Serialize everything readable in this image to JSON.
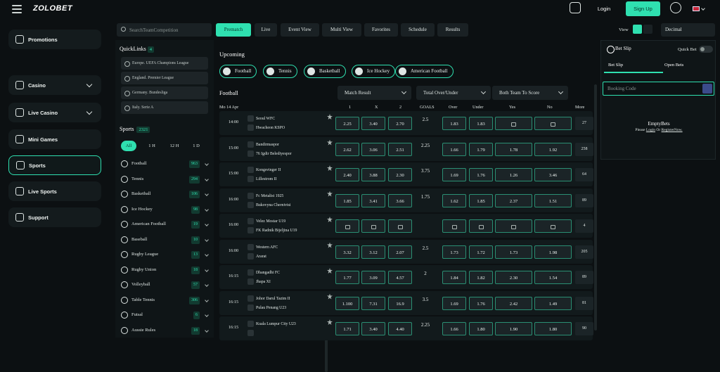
{
  "header": {
    "logo": "ZOLOBET",
    "login": "Login",
    "signup": "Sign Up",
    "lang": "EN"
  },
  "sidebar": {
    "items": [
      {
        "label": "Promotions",
        "icon": "gift-icon"
      },
      {
        "label": "Casino",
        "icon": "casino-chip-icon"
      },
      {
        "label": "Live Casino",
        "icon": "live-casino-icon"
      },
      {
        "label": "Mini Games",
        "icon": "rocket-icon"
      },
      {
        "label": "Sports",
        "icon": "ball-icon"
      },
      {
        "label": "Live Sports",
        "icon": "live-icon"
      },
      {
        "label": "Support",
        "icon": "headset-icon"
      }
    ]
  },
  "filter": {
    "search_placeholder": "SearchTeamCompetition",
    "tabs": [
      "Prematch",
      "Live",
      "Event View",
      "Multi View",
      "Favorites",
      "Schedule",
      "Results"
    ],
    "view_label": "View",
    "odds_format": "Decimal"
  },
  "quicklinks": {
    "title": "QuickLinks",
    "count": "4",
    "items": [
      "Europe. UEFA Champions League",
      "England. Premier League",
      "Germany. Bundesliga",
      "Italy. Serie A"
    ]
  },
  "sports": {
    "title": "Sports",
    "count": "2321",
    "chips": [
      "All",
      "1 H",
      "12 H",
      "1 D"
    ],
    "list": [
      {
        "name": "Football",
        "count": "963"
      },
      {
        "name": "Tennis",
        "count": "294"
      },
      {
        "name": "Basketball",
        "count": "106"
      },
      {
        "name": "Ice Hockey",
        "count": "98"
      },
      {
        "name": "American Football",
        "count": "19"
      },
      {
        "name": "Baseball",
        "count": "10"
      },
      {
        "name": "Rugby League",
        "count": "13"
      },
      {
        "name": "Rugby Union",
        "count": "18"
      },
      {
        "name": "Volleyball",
        "count": "57"
      },
      {
        "name": "Table Tennis",
        "count": "306"
      },
      {
        "name": "Futsal",
        "count": "6"
      },
      {
        "name": "Aussie Rules",
        "count": "18"
      }
    ]
  },
  "main": {
    "title": "Upcoming",
    "sport_buttons": [
      "Football",
      "Tennis",
      "Basketball",
      "Ice Hockey",
      "American Football"
    ],
    "section": "Football",
    "date": "Mo 14 Apr",
    "markets": [
      "Match Result",
      "Total Over/Under",
      "Both Team To Score"
    ],
    "cols": {
      "c1": "1",
      "cx": "X",
      "c2": "2",
      "goals": "GOALS",
      "over": "Over",
      "under": "Under",
      "yes": "Yes",
      "no": "No",
      "more": "More"
    },
    "matches": [
      {
        "time": "14:00",
        "h": "Seoul WFC",
        "a": "Hwacheon KSPO",
        "o1": "2.25",
        "ox": "3.40",
        "o2": "2.70",
        "g": "2.5",
        "ov": "1.83",
        "un": "1.83",
        "y": "",
        "n": "",
        "m": "27"
      },
      {
        "time": "15:00",
        "h": "Bandirmaspor",
        "a": "76 Igdir Belediyespor",
        "o1": "2.62",
        "ox": "3.06",
        "o2": "2.51",
        "g": "2.25",
        "ov": "1.66",
        "un": "1.79",
        "y": "1.78",
        "n": "1.92",
        "m": "258"
      },
      {
        "time": "15:00",
        "h": "Kongsvinger II",
        "a": "Lillestrom II",
        "o1": "2.40",
        "ox": "3.88",
        "o2": "2.30",
        "g": "3.75",
        "ov": "1.69",
        "un": "1.76",
        "y": "1.26",
        "n": "3.46",
        "m": "64"
      },
      {
        "time": "16:00",
        "h": "Fc Metalist 1925",
        "a": "Bukovyna Chernivtsi",
        "o1": "1.85",
        "ox": "3.41",
        "o2": "3.66",
        "g": "1.75",
        "ov": "1.62",
        "un": "1.85",
        "y": "2.37",
        "n": "1.51",
        "m": "89"
      },
      {
        "time": "16:00",
        "h": "Velez Mostar U19",
        "a": "FK Radnik Bijeljina U19",
        "o1": "",
        "ox": "",
        "o2": "",
        "g": "",
        "ov": "",
        "un": "",
        "y": "",
        "n": "",
        "m": "4"
      },
      {
        "time": "16:00",
        "h": "Western AFC",
        "a": "Ararat",
        "o1": "3.32",
        "ox": "3.12",
        "o2": "2.07",
        "g": "2.5",
        "ov": "1.73",
        "un": "1.72",
        "y": "1.73",
        "n": "1.98",
        "m": "205"
      },
      {
        "time": "16:15",
        "h": "Dhangadhi FC",
        "a": "Jhapa XI",
        "o1": "1.77",
        "ox": "3.09",
        "o2": "4.57",
        "g": "2",
        "ov": "1.84",
        "un": "1.82",
        "y": "2.30",
        "n": "1.54",
        "m": "89"
      },
      {
        "time": "16:15",
        "h": "Johor Darul Tazim II",
        "a": "Pulau Penang U23",
        "o1": "1.100",
        "ox": "7.31",
        "o2": "16.9",
        "g": "3.5",
        "ov": "1.69",
        "un": "1.76",
        "y": "2.42",
        "n": "1.49",
        "m": "81"
      },
      {
        "time": "16:15",
        "h": "Kuala Lumpur City U23",
        "a": "",
        "o1": "1.71",
        "ox": "3.40",
        "o2": "4.40",
        "g": "2.25",
        "ov": "1.66",
        "un": "1.80",
        "y": "1.90",
        "n": "1.80",
        "m": "90"
      }
    ]
  },
  "betslip": {
    "title": "Bet Slip",
    "quick": "Quick Bet",
    "tabs": [
      "Bet Slip",
      "Open Bets"
    ],
    "code_placeholder": "Booking Code",
    "empty": "EmptyBets",
    "hint": "Please",
    "login": "Login",
    "or": "Or",
    "register": "RegisterNow."
  }
}
